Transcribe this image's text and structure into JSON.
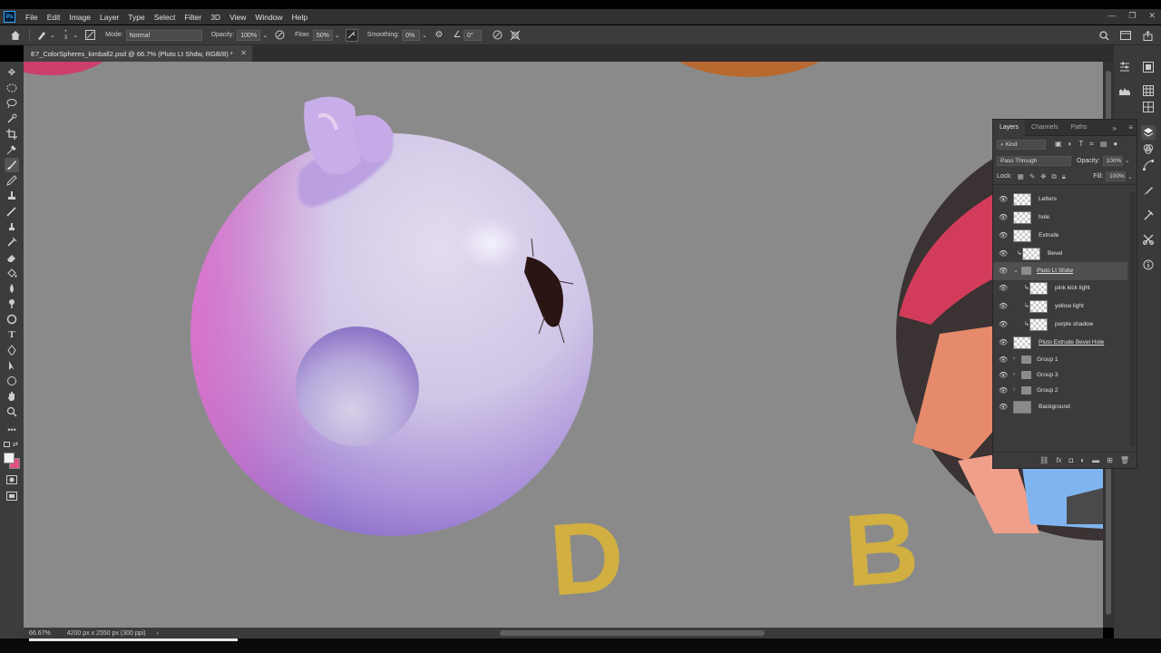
{
  "app": {
    "logo": "Ps"
  },
  "menu": [
    "File",
    "Edit",
    "Image",
    "Layer",
    "Type",
    "Select",
    "Filter",
    "3D",
    "View",
    "Window",
    "Help"
  ],
  "window_controls": {
    "minimize": "—",
    "restore": "❐",
    "close": "✕"
  },
  "options_bar": {
    "brush_size": "3",
    "mode_label": "Mode:",
    "mode_value": "Normal",
    "opacity_label": "Opacity:",
    "opacity_value": "100%",
    "flow_label": "Flow:",
    "flow_value": "50%",
    "smoothing_label": "Smoothing:",
    "smoothing_value": "0%",
    "angle_value": "0°"
  },
  "document_tab": {
    "title": "E7_ColorSpheres_kimball2.psd @ 66.7% (Pluto Lt Shdw, RGB/8) *",
    "close": "✕"
  },
  "status": {
    "zoom": "66.67%",
    "dimensions": "4200 px x 2550 px (300 ppi)",
    "arrow": "›"
  },
  "canvas": {
    "letter_left": "D",
    "letter_right": "B",
    "accent_letter_color": "#d9b43a",
    "sphere_color": "#b9a8e8"
  },
  "layers_panel": {
    "tabs": [
      "Layers",
      "Channels",
      "Paths"
    ],
    "filter_kind": "Kind",
    "blend_mode": "Pass Through",
    "opacity_label": "Opacity:",
    "opacity_value": "100%",
    "lock_label": "Lock:",
    "fill_label": "Fill:",
    "fill_value": "100%",
    "layers": [
      {
        "name": "Letters",
        "type": "layer",
        "clipped": false,
        "indent": 0
      },
      {
        "name": "hole",
        "type": "layer",
        "clipped": false,
        "indent": 0
      },
      {
        "name": "Extrude",
        "type": "layer",
        "clipped": false,
        "indent": 0
      },
      {
        "name": "Bevel",
        "type": "layer",
        "clipped": true,
        "indent": 0
      },
      {
        "name": "Pluto Lt Shdw",
        "type": "group-open",
        "clipped": false,
        "indent": 0,
        "selected": true
      },
      {
        "name": "pink kick light",
        "type": "layer",
        "clipped": true,
        "indent": 1
      },
      {
        "name": "yellow light",
        "type": "layer",
        "clipped": true,
        "indent": 1
      },
      {
        "name": "purple shadow",
        "type": "layer",
        "clipped": true,
        "indent": 1
      },
      {
        "name": "Pluto Extrude Bevel Hole",
        "type": "layer",
        "clipped": false,
        "indent": 0,
        "underlined": true
      },
      {
        "name": "Group 1",
        "type": "group",
        "clipped": false,
        "indent": 0
      },
      {
        "name": "Group 3",
        "type": "group",
        "clipped": false,
        "indent": 0
      },
      {
        "name": "Group 2",
        "type": "group",
        "clipped": false,
        "indent": 0
      },
      {
        "name": "Background",
        "type": "background",
        "clipped": false,
        "indent": 0
      }
    ]
  }
}
